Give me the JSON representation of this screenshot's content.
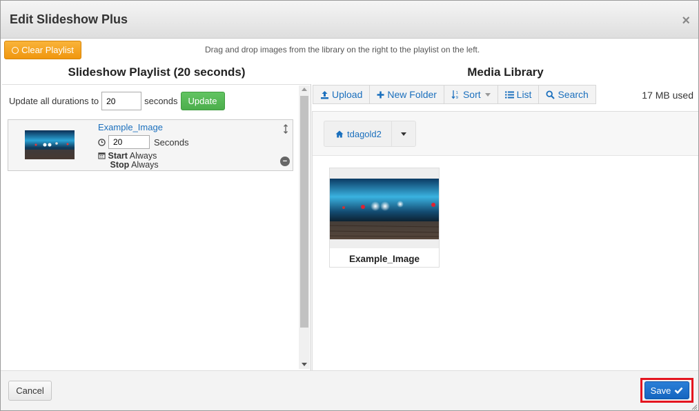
{
  "dialog": {
    "title": "Edit Slideshow Plus",
    "close_glyph": "×"
  },
  "topbar": {
    "clear_label": "Clear Playlist",
    "hint": "Drag and drop images from the library on the right to the playlist on the left."
  },
  "playlist": {
    "heading": "Slideshow Playlist (20 seconds)",
    "update_prefix": "Update all durations to",
    "update_value": "20",
    "update_suffix": "seconds",
    "update_button": "Update",
    "items": [
      {
        "name": "Example_Image",
        "duration": "20",
        "duration_unit": "Seconds",
        "start_label": "Start",
        "start_value": "Always",
        "stop_label": "Stop",
        "stop_value": "Always"
      }
    ]
  },
  "library": {
    "heading": "Media Library",
    "toolbar": {
      "upload": "Upload",
      "new_folder": "New Folder",
      "sort": "Sort",
      "list": "List",
      "search": "Search"
    },
    "usage": "17 MB used",
    "breadcrumb": {
      "folder": "tdagold2"
    },
    "items": [
      {
        "name": "Example_Image"
      }
    ]
  },
  "footer": {
    "cancel": "Cancel",
    "save": "Save"
  },
  "colors": {
    "orange": "#f0960e",
    "green": "#4cae4c",
    "blue": "#1565c0",
    "link": "#1a6fbd",
    "highlight": "#e4151f"
  }
}
